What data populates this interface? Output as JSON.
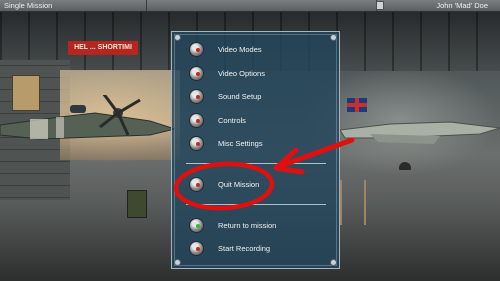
{
  "topbar": {
    "title": "Single Mission",
    "user": "John 'Mad' Doe"
  },
  "background": {
    "sign_text": "HEL ... SHORTIMI"
  },
  "menu": {
    "items": [
      {
        "label": "Video Modes",
        "icon": "red-knob-icon"
      },
      {
        "label": "Video Options",
        "icon": "red-knob-icon"
      },
      {
        "label": "Sound Setup",
        "icon": "red-knob-icon"
      },
      {
        "label": "Controls",
        "icon": "red-knob-icon"
      },
      {
        "label": "Misc Settings",
        "icon": "red-knob-icon"
      },
      {
        "label": "Quit Mission",
        "icon": "red-knob-icon"
      },
      {
        "label": "Return to mission",
        "icon": "green-knob-icon"
      },
      {
        "label": "Start Recording",
        "icon": "red-knob-icon"
      }
    ]
  },
  "annotation": {
    "color": "#e01010",
    "target": "Quit Mission"
  }
}
